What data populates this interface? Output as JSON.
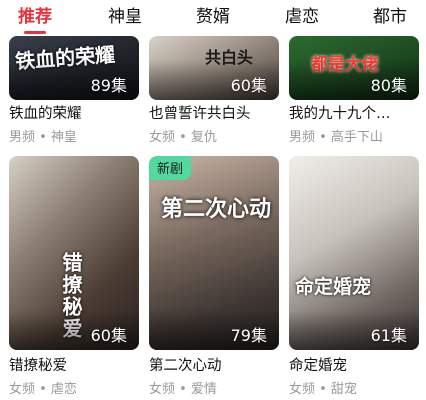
{
  "tabs": [
    {
      "label": "推荐",
      "active": true
    },
    {
      "label": "神皇"
    },
    {
      "label": "赘婿"
    },
    {
      "label": "虐恋"
    },
    {
      "label": "都市"
    }
  ],
  "colors": {
    "accent": "#e8323c",
    "badge": "#52d9a0"
  },
  "cards": [
    {
      "poster_text": "铁血的荣耀",
      "episodes": "89集",
      "title": "铁血的荣耀",
      "meta": "男频 • 神皇"
    },
    {
      "poster_text": "共白头",
      "episodes": "60集",
      "title": "也曾誓许共白头",
      "meta": "女频 • 复仇"
    },
    {
      "poster_text": "都是大佬",
      "episodes": "80集",
      "title": "我的九十九个…",
      "meta": "男频 • 高手下山"
    },
    {
      "poster_text": "错撩秘爱",
      "episodes": "60集",
      "title": "错撩秘爱",
      "meta": "女频 • 虐恋"
    },
    {
      "poster_text": "第二次心动",
      "episodes": "79集",
      "title": "第二次心动",
      "meta": "女频 • 爱情",
      "badge": "新剧"
    },
    {
      "poster_text": "命定婚宠",
      "episodes": "61集",
      "title": "命定婚宠",
      "meta": "女频 • 甜宠"
    }
  ]
}
